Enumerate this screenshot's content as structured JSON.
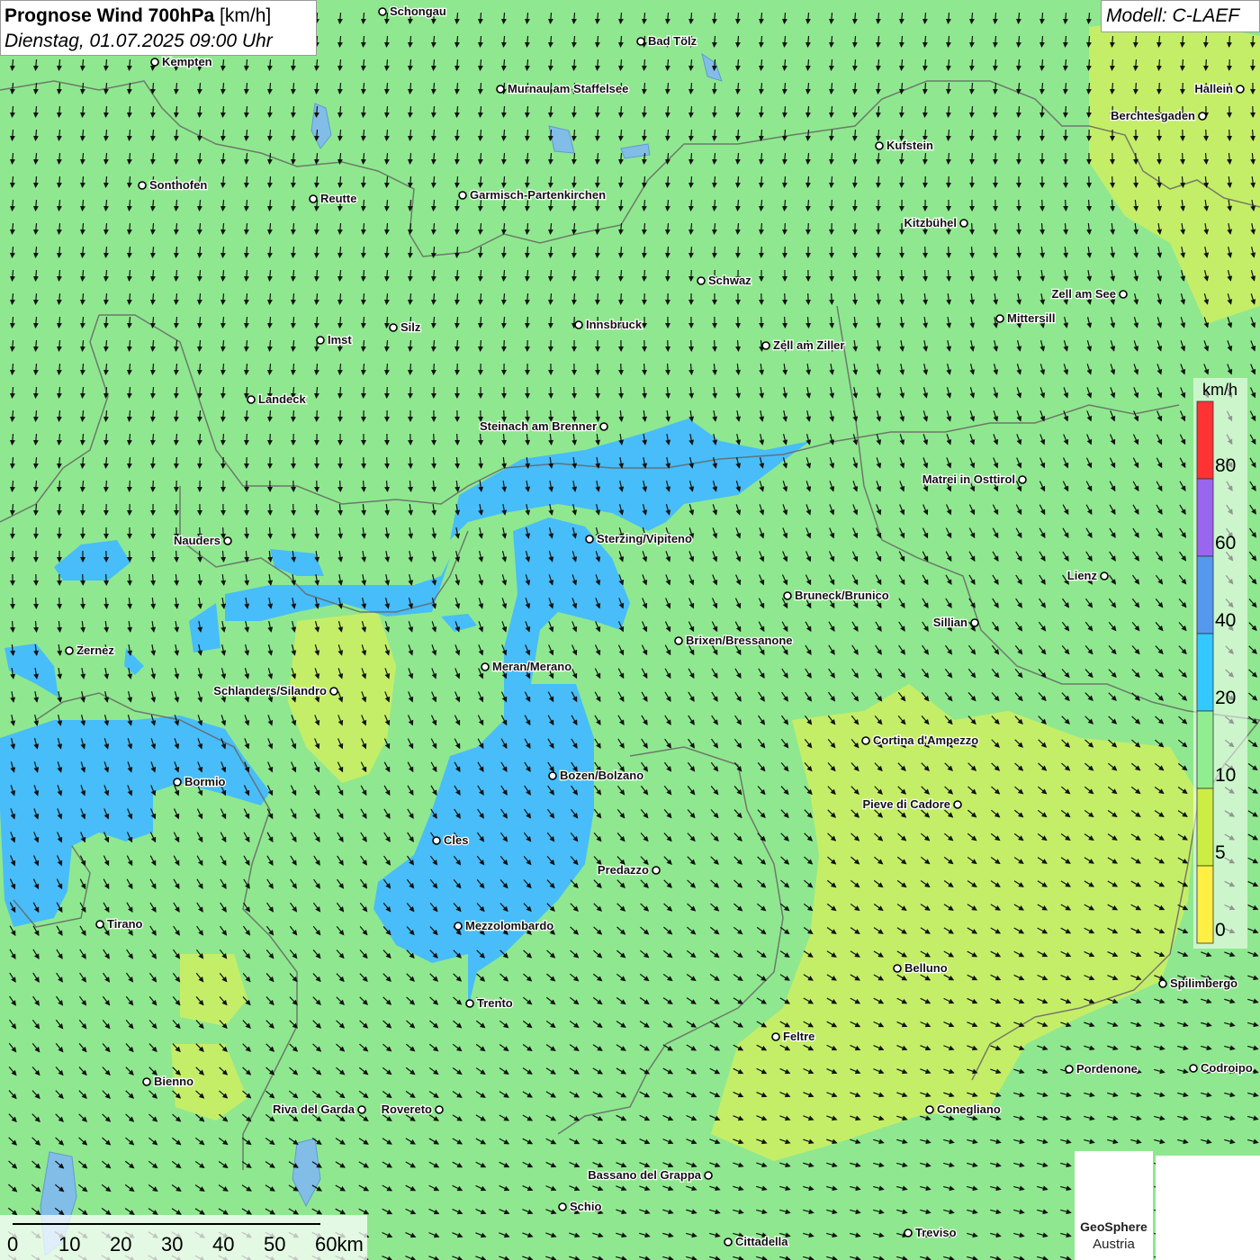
{
  "header": {
    "title_bold": "Prognose Wind 700hPa",
    "title_unit": " [km/h]",
    "datetime": "Dienstag, 01.07.2025 09:00 Uhr"
  },
  "model_label": "Modell: C-LAEF",
  "legend": {
    "unit": "km/h",
    "ticks": [
      "80",
      "60",
      "40",
      "20",
      "10",
      "5",
      "0"
    ],
    "colors": [
      "#ff3333",
      "#9966ee",
      "#5599ee",
      "#33c8ff",
      "#90ee90",
      "#ccee44",
      "#ffee44"
    ]
  },
  "scalebar": {
    "labels": [
      "0",
      "10",
      "20",
      "30",
      "40",
      "50",
      "60km"
    ]
  },
  "logos": {
    "geosphere_line1": "GeoSphere",
    "geosphere_line2": "Austria"
  },
  "colors": {
    "background": "#8fe88f",
    "low_wind": "#c8ee66",
    "high_wind": "#44bbff",
    "border": "#666666"
  },
  "cities": [
    {
      "name": "Schongau",
      "label_side": "right"
    },
    {
      "name": "Bad Tölz",
      "label_side": "right"
    },
    {
      "name": "Kempten",
      "label_side": "right"
    },
    {
      "name": "Murnau am Staffelsee",
      "label_side": "right"
    },
    {
      "name": "Hallein",
      "label_side": "left"
    },
    {
      "name": "Berchtesgaden",
      "label_side": "left"
    },
    {
      "name": "Kufstein",
      "label_side": "right"
    },
    {
      "name": "Sonthofen",
      "label_side": "right"
    },
    {
      "name": "Reutte",
      "label_side": "right"
    },
    {
      "name": "Garmisch-Partenkirchen",
      "label_side": "right"
    },
    {
      "name": "Kitzbühel",
      "label_side": "left"
    },
    {
      "name": "Schwaz",
      "label_side": "right"
    },
    {
      "name": "Zell am See",
      "label_side": "left"
    },
    {
      "name": "Silz",
      "label_side": "right"
    },
    {
      "name": "Innsbruck",
      "label_side": "right"
    },
    {
      "name": "Mittersill",
      "label_side": "right"
    },
    {
      "name": "Imst",
      "label_side": "right"
    },
    {
      "name": "Zell am Ziller",
      "label_side": "right"
    },
    {
      "name": "Landeck",
      "label_side": "right"
    },
    {
      "name": "Steinach am Brenner",
      "label_side": "left"
    },
    {
      "name": "Matrei in Osttirol",
      "label_side": "left"
    },
    {
      "name": "Nauders",
      "label_side": "left"
    },
    {
      "name": "Sterzing/Vipiteno",
      "label_side": "right"
    },
    {
      "name": "Lienz",
      "label_side": "left"
    },
    {
      "name": "Bruneck/Brunico",
      "label_side": "right"
    },
    {
      "name": "Sillian",
      "label_side": "left"
    },
    {
      "name": "Brixen/Bressanone",
      "label_side": "right"
    },
    {
      "name": "Zernez",
      "label_side": "right"
    },
    {
      "name": "Meran/Merano",
      "label_side": "right"
    },
    {
      "name": "Schlanders/Silandro",
      "label_side": "left"
    },
    {
      "name": "Cortina d'Ampezzo",
      "label_side": "right"
    },
    {
      "name": "Bozen/Bolzano",
      "label_side": "right"
    },
    {
      "name": "Bormio",
      "label_side": "right"
    },
    {
      "name": "Pieve di Cadore",
      "label_side": "left"
    },
    {
      "name": "Cles",
      "label_side": "right"
    },
    {
      "name": "Predazzo",
      "label_side": "left"
    },
    {
      "name": "Tirano",
      "label_side": "right"
    },
    {
      "name": "Mezzolombardo",
      "label_side": "right"
    },
    {
      "name": "Belluno",
      "label_side": "right"
    },
    {
      "name": "Spilimbergo",
      "label_side": "right"
    },
    {
      "name": "Trento",
      "label_side": "right"
    },
    {
      "name": "Feltre",
      "label_side": "right"
    },
    {
      "name": "Pordenone",
      "label_side": "right"
    },
    {
      "name": "Codroipo",
      "label_side": "right"
    },
    {
      "name": "Bienno",
      "label_side": "right"
    },
    {
      "name": "Riva del Garda",
      "label_side": "left"
    },
    {
      "name": "Rovereto",
      "label_side": "left"
    },
    {
      "name": "Conegliano",
      "label_side": "right"
    },
    {
      "name": "Bassano del Grappa",
      "label_side": "left"
    },
    {
      "name": "Schio",
      "label_side": "right"
    },
    {
      "name": "Treviso",
      "label_side": "right"
    },
    {
      "name": "Cittadella",
      "label_side": "right"
    }
  ]
}
